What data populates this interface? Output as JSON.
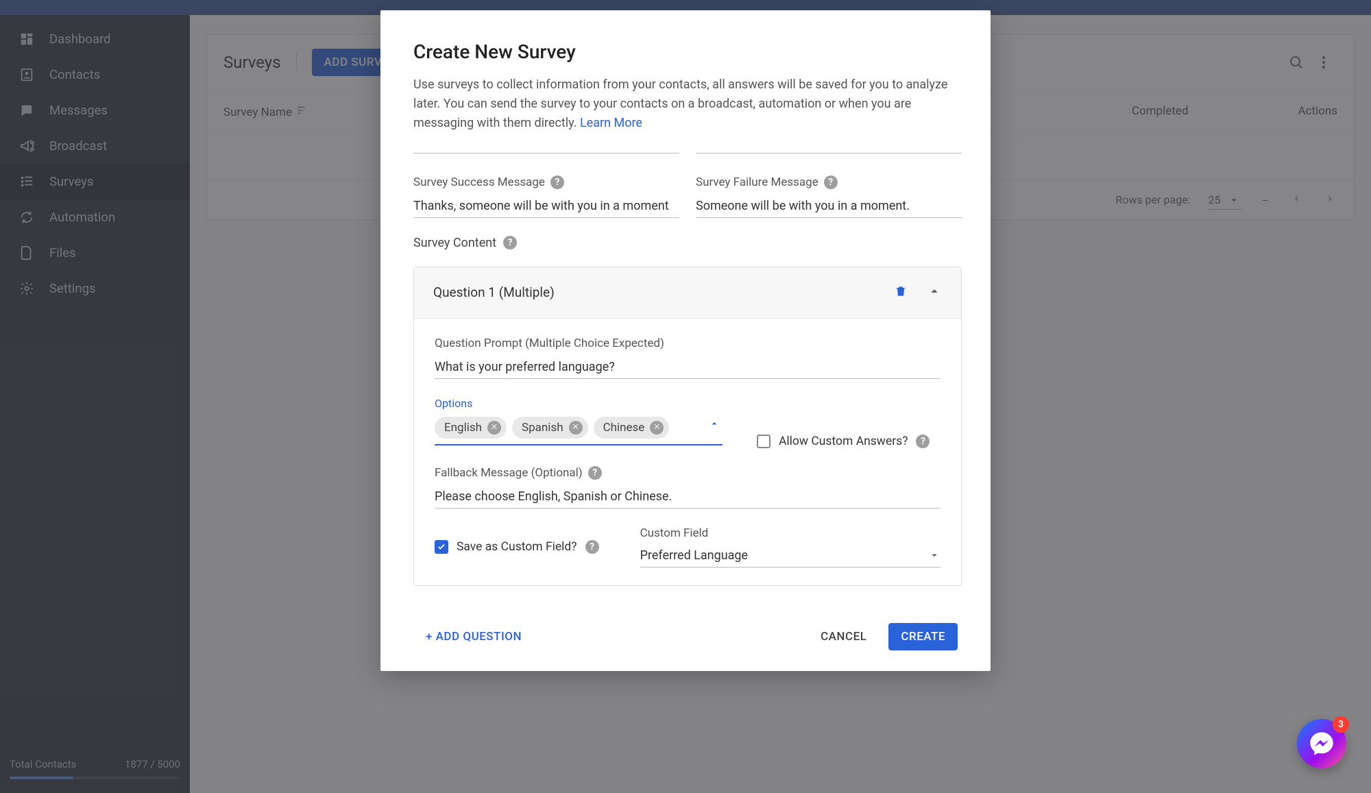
{
  "sidebar": {
    "items": [
      {
        "label": "Dashboard",
        "icon": "dashboard-icon"
      },
      {
        "label": "Contacts",
        "icon": "contacts-icon"
      },
      {
        "label": "Messages",
        "icon": "messages-icon"
      },
      {
        "label": "Broadcast",
        "icon": "broadcast-icon"
      },
      {
        "label": "Surveys",
        "icon": "surveys-icon",
        "active": true
      },
      {
        "label": "Automation",
        "icon": "automation-icon"
      },
      {
        "label": "Files",
        "icon": "files-icon"
      },
      {
        "label": "Settings",
        "icon": "settings-icon"
      }
    ],
    "footer_label": "Total Contacts",
    "footer_count": "1877 / 5000"
  },
  "page": {
    "title": "Surveys",
    "add_button": "ADD SURVEY",
    "col_name": "Survey Name",
    "col_completed": "Completed",
    "col_actions": "Actions",
    "rows_label": "Rows per page:",
    "rows_value": "25",
    "range": "–"
  },
  "modal": {
    "title": "Create New Survey",
    "desc_prefix": "Use surveys to collect information from your contacts, all answers will be saved for you to analyze later. You can send the survey to your contacts on a broadcast, automation or when you are messaging with them directly. ",
    "learn_more": "Learn More",
    "success_label": "Survey Success Message",
    "success_value": "Thanks, someone will be with you in a moment",
    "failure_label": "Survey Failure Message",
    "failure_value": "Someone will be with you in a moment.",
    "content_label": "Survey Content",
    "question": {
      "header": "Question 1 (Multiple)",
      "prompt_label": "Question Prompt (Multiple Choice Expected)",
      "prompt_value": "What is your preferred language?",
      "options_label": "Options",
      "chips": [
        "English",
        "Spanish",
        "Chinese"
      ],
      "allow_custom_label": "Allow Custom Answers?",
      "fallback_label": "Fallback Message (Optional)",
      "fallback_value": "Please choose English, Spanish or Chinese.",
      "save_cf_label": "Save as Custom Field?",
      "cf_label": "Custom Field",
      "cf_value": "Preferred Language"
    },
    "add_question": "+ ADD QUESTION",
    "cancel": "CANCEL",
    "create": "CREATE"
  },
  "fab": {
    "badge": "3"
  }
}
